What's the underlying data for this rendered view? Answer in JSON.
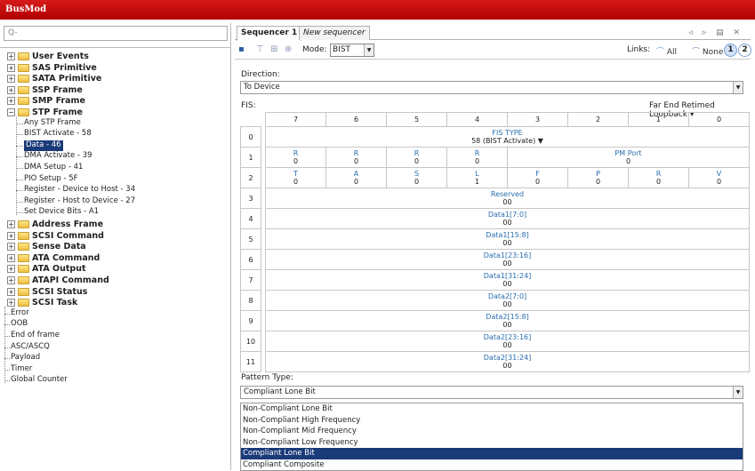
{
  "app": {
    "title": "BusMod"
  },
  "search": {
    "placeholder": "Q-"
  },
  "tree": {
    "groups_top": [
      "User Events",
      "SAS Primitive",
      "SATA Primitive",
      "SSP Frame",
      "SMP Frame"
    ],
    "expanded_group": "STP Frame",
    "stp_children": [
      "Any STP Frame",
      "BIST Activate - 58",
      "Data - 46",
      "DMA Activate - 39",
      "DMA Setup - 41",
      "PIO Setup - 5F",
      "Register - Device to Host - 34",
      "Register - Host to Device - 27",
      "Set Device Bits - A1"
    ],
    "selected_child": "Data - 46",
    "groups_bottom": [
      "Address Frame",
      "SCSI Command",
      "Sense Data",
      "ATA Command",
      "ATA Output",
      "ATAPI Command",
      "SCSI Status",
      "SCSI Task"
    ],
    "leaves": [
      "Error",
      "OOB",
      "End of frame",
      "ASC/ASCQ",
      "Payload",
      "Timer",
      "Global Counter"
    ]
  },
  "tabs": [
    {
      "label": "Sequencer 1",
      "active": true
    },
    {
      "label": "New sequencer",
      "active": false
    }
  ],
  "tab_controls": "◃ ▹ ▤ ✕",
  "toolbar": {
    "mode_label": "Mode:",
    "mode_value": "BIST",
    "links_label": "Links:",
    "links_all": "All",
    "links_none": "None",
    "link1": "1",
    "link2": "2"
  },
  "direction": {
    "label": "Direction:",
    "value": "To Device"
  },
  "fis": {
    "label": "FIS:",
    "right_label": "Far End Retimed Loopback ▾",
    "bit_headers": [
      "7",
      "6",
      "5",
      "4",
      "3",
      "2",
      "1",
      "0"
    ],
    "row0": {
      "num": "0",
      "name": "FIS TYPE",
      "value": "58 (BIST Activate) ▼"
    },
    "row1": {
      "num": "1",
      "bits": [
        {
          "name": "R",
          "value": "0"
        },
        {
          "name": "R",
          "value": "0"
        },
        {
          "name": "R",
          "value": "0"
        },
        {
          "name": "R",
          "value": "0"
        }
      ],
      "pm": {
        "name": "PM Port",
        "value": "0"
      }
    },
    "row2": {
      "num": "2",
      "bits": [
        {
          "name": "T",
          "value": "0"
        },
        {
          "name": "A",
          "value": "0"
        },
        {
          "name": "S",
          "value": "0"
        },
        {
          "name": "L",
          "value": "1"
        },
        {
          "name": "F",
          "value": "0"
        },
        {
          "name": "P",
          "value": "0"
        },
        {
          "name": "R",
          "value": "0"
        },
        {
          "name": "V",
          "value": "0"
        }
      ]
    },
    "full_rows": [
      {
        "num": "3",
        "name": "Reserved",
        "value": "00"
      },
      {
        "num": "4",
        "name": "Data1[7:0]",
        "value": "00"
      },
      {
        "num": "5",
        "name": "Data1[15:8]",
        "value": "00"
      },
      {
        "num": "6",
        "name": "Data1[23:16]",
        "value": "00"
      },
      {
        "num": "7",
        "name": "Data1[31:24]",
        "value": "00"
      },
      {
        "num": "8",
        "name": "Data2[7:0]",
        "value": "00"
      },
      {
        "num": "9",
        "name": "Data2[15:8]",
        "value": "00"
      },
      {
        "num": "10",
        "name": "Data2[23:16]",
        "value": "00"
      },
      {
        "num": "11",
        "name": "Data2[31:24]",
        "value": "00"
      }
    ]
  },
  "pattern": {
    "label": "Pattern Type:",
    "value": "Compliant Lone Bit",
    "options": [
      "Non-Compliant Lone Bit",
      "Non-Compliant High Frequency",
      "Non-Compliant Mid Frequency",
      "Non-Compliant Low Frequency",
      "Compliant Lone Bit",
      "Compliant Composite"
    ],
    "selected": "Compliant Lone Bit"
  }
}
